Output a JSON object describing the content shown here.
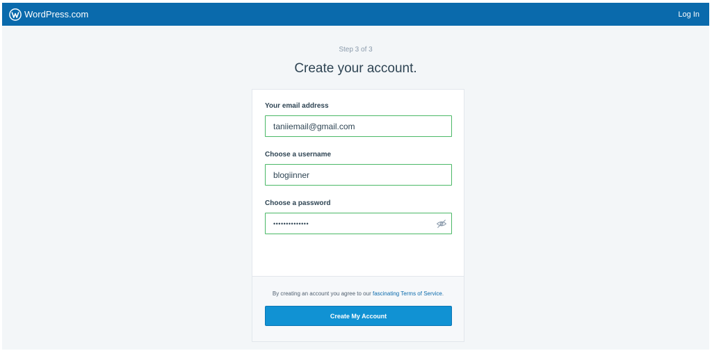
{
  "masthead": {
    "brand": "WordPress.com",
    "login_label": "Log In"
  },
  "signup": {
    "step": "Step 3 of 3",
    "title": "Create your account.",
    "email": {
      "label": "Your email address",
      "value": "taniiemail@gmail.com"
    },
    "username": {
      "label": "Choose a username",
      "value": "blogiinner"
    },
    "password": {
      "label": "Choose a password",
      "value": "••••••••••••••"
    },
    "tos": {
      "prefix": "By creating an account you agree to our ",
      "link_fascinating": "fascinating",
      "link_terms": "Terms of Service",
      "suffix": "."
    },
    "submit_label": "Create My Account"
  },
  "colors": {
    "masthead": "#0a6aac",
    "background": "#f3f6f8",
    "field_border": "#4ab866",
    "button": "#1192d3",
    "link": "#0a6aac"
  },
  "icons": [
    "wordpress-logo-icon",
    "eye-hidden-icon"
  ]
}
